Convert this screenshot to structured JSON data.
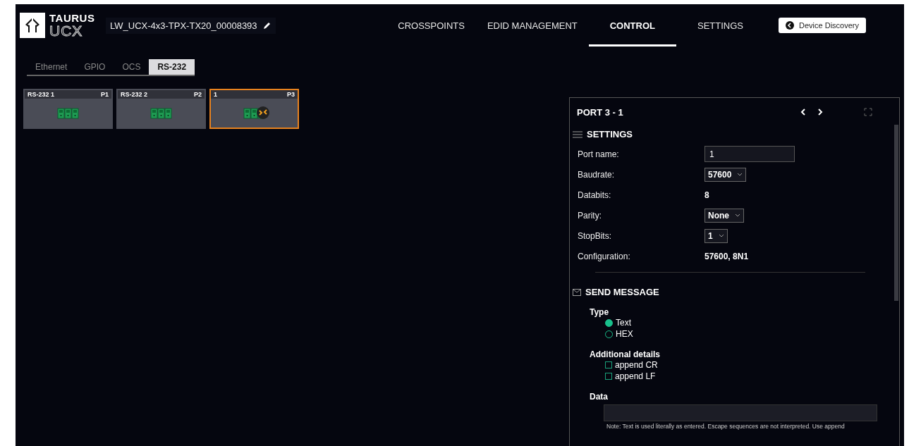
{
  "header": {
    "logo": {
      "brand": "TAURUS",
      "product": "UCX"
    },
    "device_name": "LW_UCX-4x3-TPX-TX20_00008393",
    "nav": [
      {
        "label": "CROSSPOINTS",
        "selected": false
      },
      {
        "label": "EDID MANAGEMENT",
        "selected": false
      },
      {
        "label": "CONTROL",
        "selected": true
      },
      {
        "label": "SETTINGS",
        "selected": false
      }
    ],
    "discovery_button": "Device Discovery"
  },
  "subtabs": [
    {
      "label": "Ethernet",
      "selected": false
    },
    {
      "label": "GPIO",
      "selected": false
    },
    {
      "label": "OCS",
      "selected": false
    },
    {
      "label": "RS-232",
      "selected": true
    }
  ],
  "ports": [
    {
      "name": "RS-232 1",
      "port": "P1",
      "selected": false,
      "linked": false
    },
    {
      "name": "RS-232 2",
      "port": "P2",
      "selected": false,
      "linked": false
    },
    {
      "name": "1",
      "port": "P3",
      "selected": true,
      "linked": true
    }
  ],
  "panel": {
    "title": "PORT 3 - 1",
    "settings": {
      "title": "SETTINGS",
      "rows": [
        {
          "label": "Port name:",
          "value": "1",
          "kind": "input"
        },
        {
          "label": "Baudrate:",
          "value": "57600",
          "kind": "select"
        },
        {
          "label": "Databits:",
          "value": "8",
          "kind": "text"
        },
        {
          "label": "Parity:",
          "value": "None",
          "kind": "select"
        },
        {
          "label": "StopBits:",
          "value": "1",
          "kind": "select"
        },
        {
          "label": "Configuration:",
          "value": "57600, 8N1",
          "kind": "text"
        }
      ]
    },
    "send_message": {
      "title": "SEND MESSAGE",
      "type_label": "Type",
      "type_options": [
        {
          "label": "Text",
          "selected": true
        },
        {
          "label": "HEX",
          "selected": false
        }
      ],
      "details_label": "Additional details",
      "details": [
        {
          "label": "append CR",
          "checked": false
        },
        {
          "label": "append LF",
          "checked": false
        }
      ],
      "data_label": "Data",
      "note": "Note: Text is used literally as entered. Escape sequences are not interpreted. Use append"
    }
  }
}
